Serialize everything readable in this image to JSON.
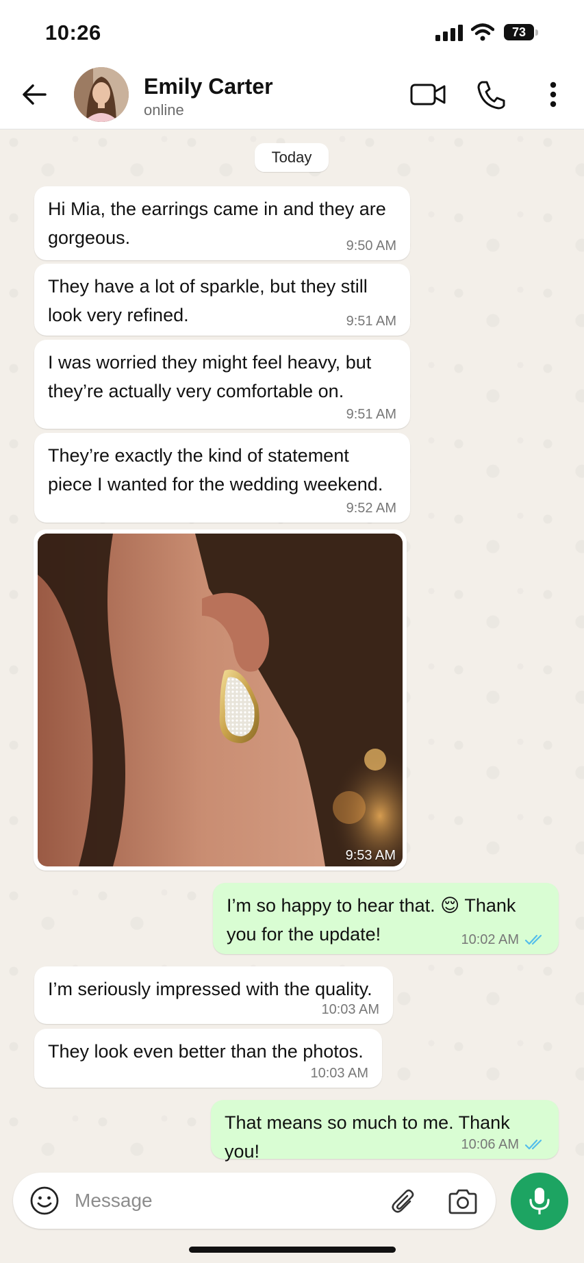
{
  "status_bar": {
    "time": "10:26",
    "battery": "73"
  },
  "header": {
    "contact_name": "Emily Carter",
    "contact_status": "online",
    "icons": [
      "back-arrow-icon",
      "video-call-icon",
      "phone-icon",
      "more-options-icon"
    ]
  },
  "chat": {
    "date_label": "Today",
    "messages": [
      {
        "direction": "in",
        "text": "Hi Mia, the earrings came in and they are gorgeous.",
        "time": "9:50 AM"
      },
      {
        "direction": "in",
        "text": "They have a lot of sparkle, but they still look very refined.",
        "time": "9:51 AM"
      },
      {
        "direction": "in",
        "text": "I was worried they might feel heavy, but they’re actually very comfortable on.",
        "time": "9:51 AM"
      },
      {
        "direction": "in",
        "text": "They’re exactly the kind of statement piece I wanted for the wedding weekend.",
        "time": "9:52 AM"
      },
      {
        "direction": "in",
        "type": "photo",
        "subject": "gold pavé teardrop earring worn on ear",
        "time": "9:53 AM"
      },
      {
        "direction": "out",
        "text": "I’m so happy to hear that. 😌 Thank you for the update!",
        "time": "10:02 AM",
        "status": "read"
      },
      {
        "direction": "in",
        "text": "I’m seriously impressed with the quality.",
        "time": "10:03 AM"
      },
      {
        "direction": "in",
        "text": "They look even better than the photos.",
        "time": "10:03 AM"
      },
      {
        "direction": "out",
        "text": "That means so much to me. Thank you!",
        "time": "10:06 AM",
        "status": "read"
      }
    ]
  },
  "composer": {
    "placeholder": "Message"
  },
  "colors": {
    "outgoing_bubble": "#d9fdd3",
    "incoming_bubble": "#ffffff",
    "read_ticks": "#53bdeb",
    "mic_button": "#1da462",
    "chat_background": "#f3efe9"
  }
}
